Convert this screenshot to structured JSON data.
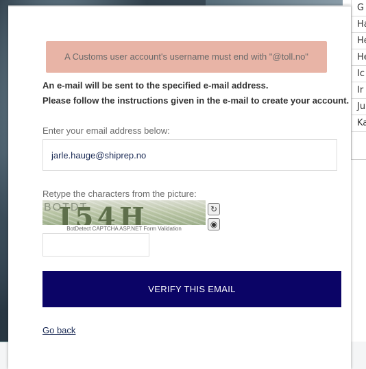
{
  "dialog": {
    "alert_message": "A Customs user account's username must end with \"@toll.no\"",
    "info_line_1": "An e-mail will be sent to the specified e-mail address.",
    "info_line_2": "Please follow the instructions given in the e-mail to create your account.",
    "email_label": "Enter your email address below:",
    "email_value": "jarle.hauge@shiprep.no",
    "captcha_label": "Retype the characters from the picture:",
    "captcha_code": "J54H",
    "captcha_bg_text": "BOTDT",
    "captcha_caption": "BotDetect CAPTCHA ASP.NET Form Validation",
    "captcha_input_value": "",
    "verify_button_label": "VERIFY THIS EMAIL",
    "go_back_label": "Go back"
  },
  "side_list": {
    "rows": [
      "G",
      "Ha",
      "He",
      "He",
      "Ic",
      "Ir",
      "Ju",
      "Ka"
    ]
  },
  "icons": {
    "reload": "reload-icon",
    "sound": "sound-icon"
  },
  "colors": {
    "alert_bg": "#e8b4a6",
    "primary_button": "#0b0466"
  }
}
